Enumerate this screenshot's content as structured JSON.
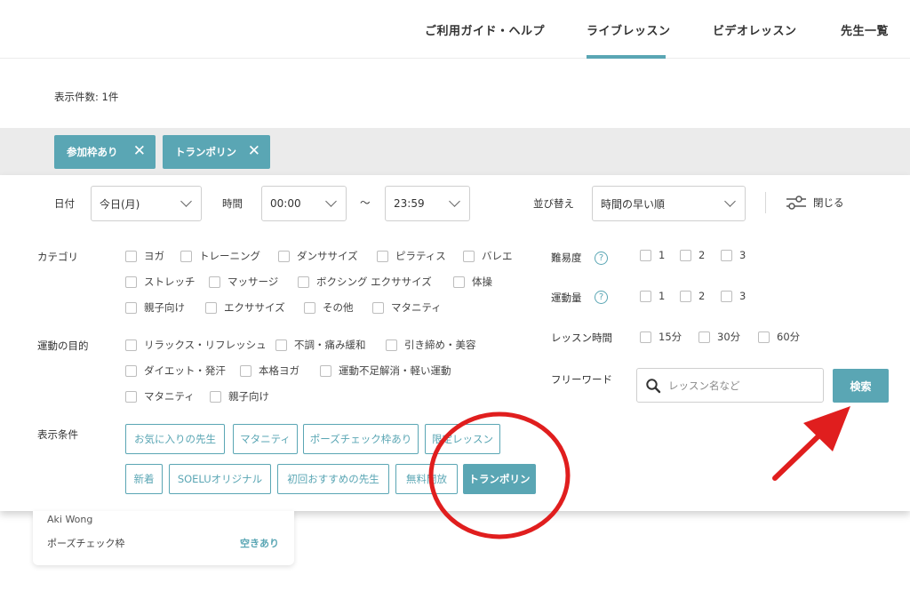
{
  "nav": {
    "items": [
      "ご利用ガイド・ヘルプ",
      "ライブレッスン",
      "ビデオレッスン",
      "先生一覧"
    ]
  },
  "results": {
    "count_label": "表示件数: 1件"
  },
  "active_filters": [
    "参加枠あり",
    "トランポリン"
  ],
  "filters": {
    "date_label": "日付",
    "date_value": "今日(月)",
    "time_label": "時間",
    "time_from": "00:00",
    "time_sep": "〜",
    "time_to": "23:59",
    "sort_label": "並び替え",
    "sort_value": "時間の早い順",
    "close_label": "閉じる",
    "category_label": "カテゴリ",
    "categories": [
      "ヨガ",
      "トレーニング",
      "ダンササイズ",
      "ピラティス",
      "バレエ",
      "ストレッチ",
      "マッサージ",
      "ボクシング エクササイズ",
      "体操",
      "親子向け",
      "エクササイズ",
      "その他",
      "マタニティ"
    ],
    "purpose_label": "運動の目的",
    "purposes": [
      "リラックス・リフレッシュ",
      "不調・痛み緩和",
      "引き締め・美容",
      "ダイエット・発汗",
      "本格ヨガ",
      "運動不足解消・軽い運動",
      "マタニティ",
      "親子向け"
    ],
    "difficulty_label": "難易度",
    "difficulty_options": [
      "1",
      "2",
      "3"
    ],
    "intensity_label": "運動量",
    "intensity_options": [
      "1",
      "2",
      "3"
    ],
    "duration_label": "レッスン時間",
    "duration_options": [
      "15分",
      "30分",
      "60分"
    ],
    "freeword_label": "フリーワード",
    "freeword_placeholder": "レッスン名など",
    "search_label": "検索",
    "help_mark": "?",
    "display_label": "表示条件",
    "display_conditions": [
      "お気に入りの先生",
      "マタニティ",
      "ポーズチェック枠あり",
      "限定レッスン",
      "新着",
      "SOELUオリジナル",
      "初回おすすめの先生",
      "無料開放",
      "トランポリン"
    ]
  },
  "card": {
    "teacher": "Aki Wong",
    "row_label": "ポーズチェック枠",
    "row_status": "空きあり"
  },
  "colors": {
    "accent": "#5aa6b4",
    "annotation": "#e01e1e"
  }
}
